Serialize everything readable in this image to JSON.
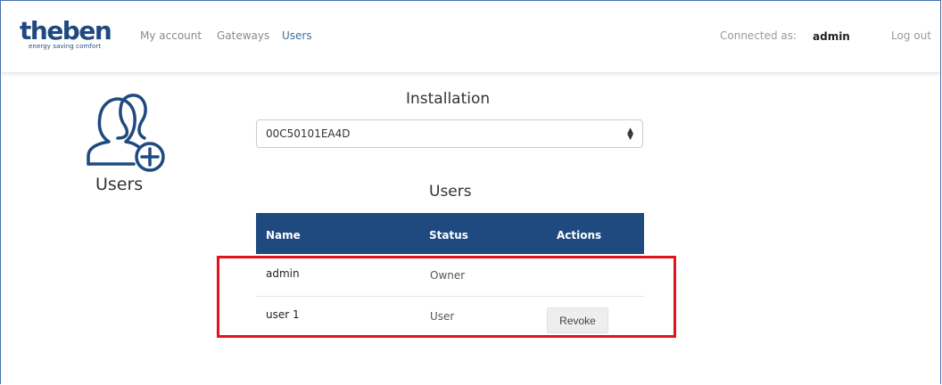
{
  "brand": {
    "name": "theben",
    "tagline": "energy saving comfort",
    "color": "#1f4a80"
  },
  "nav": {
    "links": [
      "My account",
      "Gateways",
      "Users"
    ],
    "active": "Users",
    "connected_label": "Connected as:",
    "connected_user": "admin",
    "logout": "Log out"
  },
  "sidebar": {
    "icon": "users-add-icon",
    "label": "Users"
  },
  "installation": {
    "title": "Installation",
    "selected": "00C50101EA4D"
  },
  "users_table": {
    "title": "Users",
    "header_color": "#1f4a80",
    "columns": [
      "Name",
      "Status",
      "Actions"
    ],
    "rows": [
      {
        "name": "admin",
        "status": "Owner",
        "action": ""
      },
      {
        "name": "user 1",
        "status": "User",
        "action": "Revoke"
      }
    ]
  },
  "annotation_color": "#e0141b"
}
